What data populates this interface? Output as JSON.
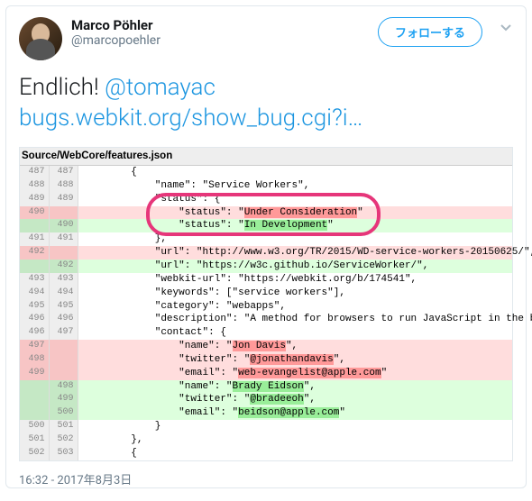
{
  "author": {
    "name": "Marco Pöhler",
    "handle": "@marcopoehler"
  },
  "follow_label": "フォローする",
  "tweet": {
    "lead": "Endlich! ",
    "mention": "@tomayac",
    "url_text": "bugs.webkit.org/show_bug.cgi?i…"
  },
  "timestamp": "16:32 - 2017年8月3日",
  "file_header": "Source/WebCore/features.json",
  "diff": [
    {
      "l": "487",
      "r": "487",
      "cls": "ctx",
      "text": "        {"
    },
    {
      "l": "488",
      "r": "488",
      "cls": "ctx",
      "text": "            \"name\": \"Service Workers\","
    },
    {
      "l": "489",
      "r": "489",
      "cls": "ctx",
      "text": "            \"status\": {"
    },
    {
      "l": "490",
      "r": "",
      "cls": "rem",
      "text": "                \"status\": \"",
      "hl": "Under Consideration",
      "tail": "\""
    },
    {
      "l": "",
      "r": "490",
      "cls": "add",
      "text": "                \"status\": \"",
      "hl": "In Development",
      "tail": "\""
    },
    {
      "l": "491",
      "r": "491",
      "cls": "ctx",
      "text": "            },"
    },
    {
      "l": "492",
      "r": "",
      "cls": "rem",
      "text": "            \"url\": \"http://www.w3.org/TR/2015/WD-service-workers-20150625/\","
    },
    {
      "l": "",
      "r": "492",
      "cls": "add",
      "text": "            \"url\": \"https://w3c.github.io/ServiceWorker/\","
    },
    {
      "l": "493",
      "r": "493",
      "cls": "ctx",
      "text": "            \"webkit-url\": \"https://webkit.org/b/174541\","
    },
    {
      "l": "494",
      "r": "494",
      "cls": "ctx",
      "text": "            \"keywords\": [\"service workers\"],"
    },
    {
      "l": "495",
      "r": "495",
      "cls": "ctx",
      "text": "            \"category\": \"webapps\","
    },
    {
      "l": "496",
      "r": "496",
      "cls": "ctx",
      "wrap": true,
      "text": "            \"description\": \"A method for browsers to run JavaScript in the background to handle network requests and manage cached responses. Service Workers offers a replacement for Application Cache.\","
    },
    {
      "l": "496",
      "r": "497",
      "cls": "ctx",
      "text": "            \"contact\": {"
    },
    {
      "l": "497",
      "r": "",
      "cls": "rem",
      "text": "                \"name\": \"",
      "hl": "Jon Davis",
      "tail": "\","
    },
    {
      "l": "498",
      "r": "",
      "cls": "rem",
      "text": "                \"twitter\": \"",
      "hl": "@jonathandavis",
      "tail": "\","
    },
    {
      "l": "499",
      "r": "",
      "cls": "rem",
      "text": "                \"email\": \"",
      "hl": "web-evangelist@apple.com",
      "tail": "\""
    },
    {
      "l": "",
      "r": "498",
      "cls": "add",
      "text": "                \"name\": \"",
      "hl": "Brady Eidson",
      "tail": "\","
    },
    {
      "l": "",
      "r": "499",
      "cls": "add",
      "text": "                \"twitter\": \"",
      "hl": "@bradeeoh",
      "tail": "\","
    },
    {
      "l": "",
      "r": "500",
      "cls": "add",
      "text": "                \"email\": \"",
      "hl": "beidson@apple.com",
      "tail": "\""
    },
    {
      "l": "500",
      "r": "501",
      "cls": "ctx",
      "text": "            }"
    },
    {
      "l": "501",
      "r": "502",
      "cls": "ctx",
      "text": "        },"
    },
    {
      "l": "502",
      "r": "503",
      "cls": "ctx",
      "text": "        {"
    }
  ]
}
